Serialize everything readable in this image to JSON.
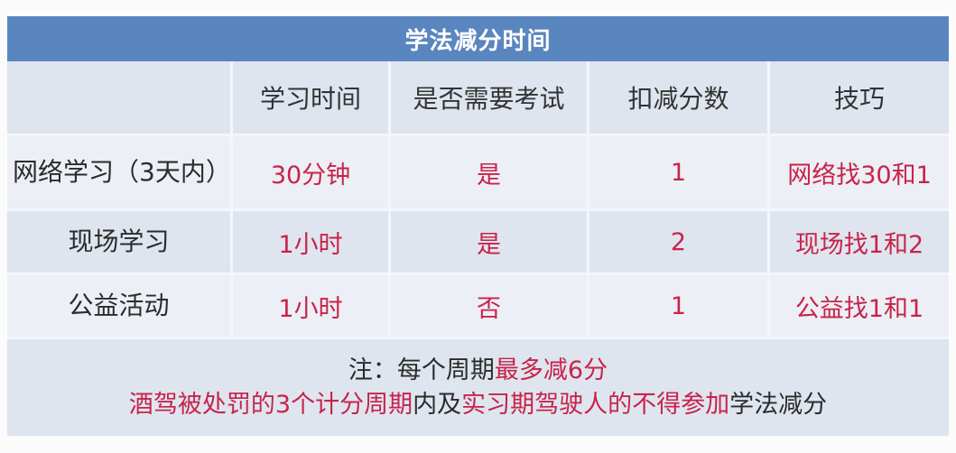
{
  "title": "学法减分时间",
  "headers": [
    "",
    "学习时间",
    "是否需要考试",
    "扣减分数",
    "技巧"
  ],
  "rows": [
    {
      "label": "网络学习（3天内）",
      "time": "30分钟",
      "exam": "是",
      "points": "1",
      "tip": "网络找30和1"
    },
    {
      "label": "现场学习",
      "time": "1小时",
      "exam": "是",
      "points": "2",
      "tip": "现场找1和2"
    },
    {
      "label": "公益活动",
      "time": "1小时",
      "exam": "否",
      "points": "1",
      "tip": "公益找1和1"
    }
  ],
  "note": {
    "line1_prefix": "注：每个周期",
    "line1_highlight": "最多减6分",
    "line2_part1": "酒驾被处罚的3个计分周期",
    "line2_part2": "内及",
    "line2_part3": "实习期驾驶人的不得参加",
    "line2_part4": "学法减分"
  },
  "colors": {
    "header_bar": "#5a86bf",
    "highlight_red": "#c8234a",
    "row_dark": "#dfe5ef",
    "row_light": "#eceff5"
  }
}
